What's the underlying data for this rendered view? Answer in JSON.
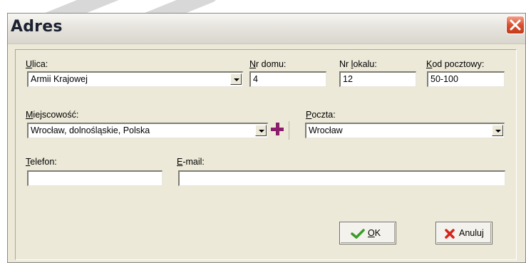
{
  "window": {
    "title": "Adres",
    "close_icon": "close-icon"
  },
  "fields": {
    "ulica": {
      "label": "Ulica:",
      "accesskey": "U",
      "value": "Armii Krajowej"
    },
    "nr_domu": {
      "label": "Nr domu:",
      "accesskey": "N",
      "value": "4"
    },
    "nr_lokalu": {
      "label": "Nr lokalu:",
      "accesskey": "l",
      "value": "12"
    },
    "kod_pocztowy": {
      "label": "Kod pocztowy:",
      "accesskey": "K",
      "value": "50-100"
    },
    "miejscowosc": {
      "label": "Miejscowość:",
      "accesskey": "M",
      "value": "Wrocław, dolnośląskie, Polska"
    },
    "poczta": {
      "label": "Poczta:",
      "accesskey": "P",
      "value": "Wrocław"
    },
    "telefon": {
      "label": "Telefon:",
      "accesskey": "T",
      "value": ""
    },
    "email": {
      "label": "E-mail:",
      "accesskey": "E",
      "value": ""
    }
  },
  "buttons": {
    "ok": {
      "label": "OK",
      "icon": "check-icon",
      "color": "#3a9b2a"
    },
    "cancel": {
      "label": "Anuluj",
      "icon": "x-icon",
      "color": "#d4241b"
    },
    "add_locality_icon": "plus-icon"
  },
  "colors": {
    "plus": "#8b1d6d",
    "dialog_bg": "#ece9d8",
    "close_button": "#d9502f"
  }
}
